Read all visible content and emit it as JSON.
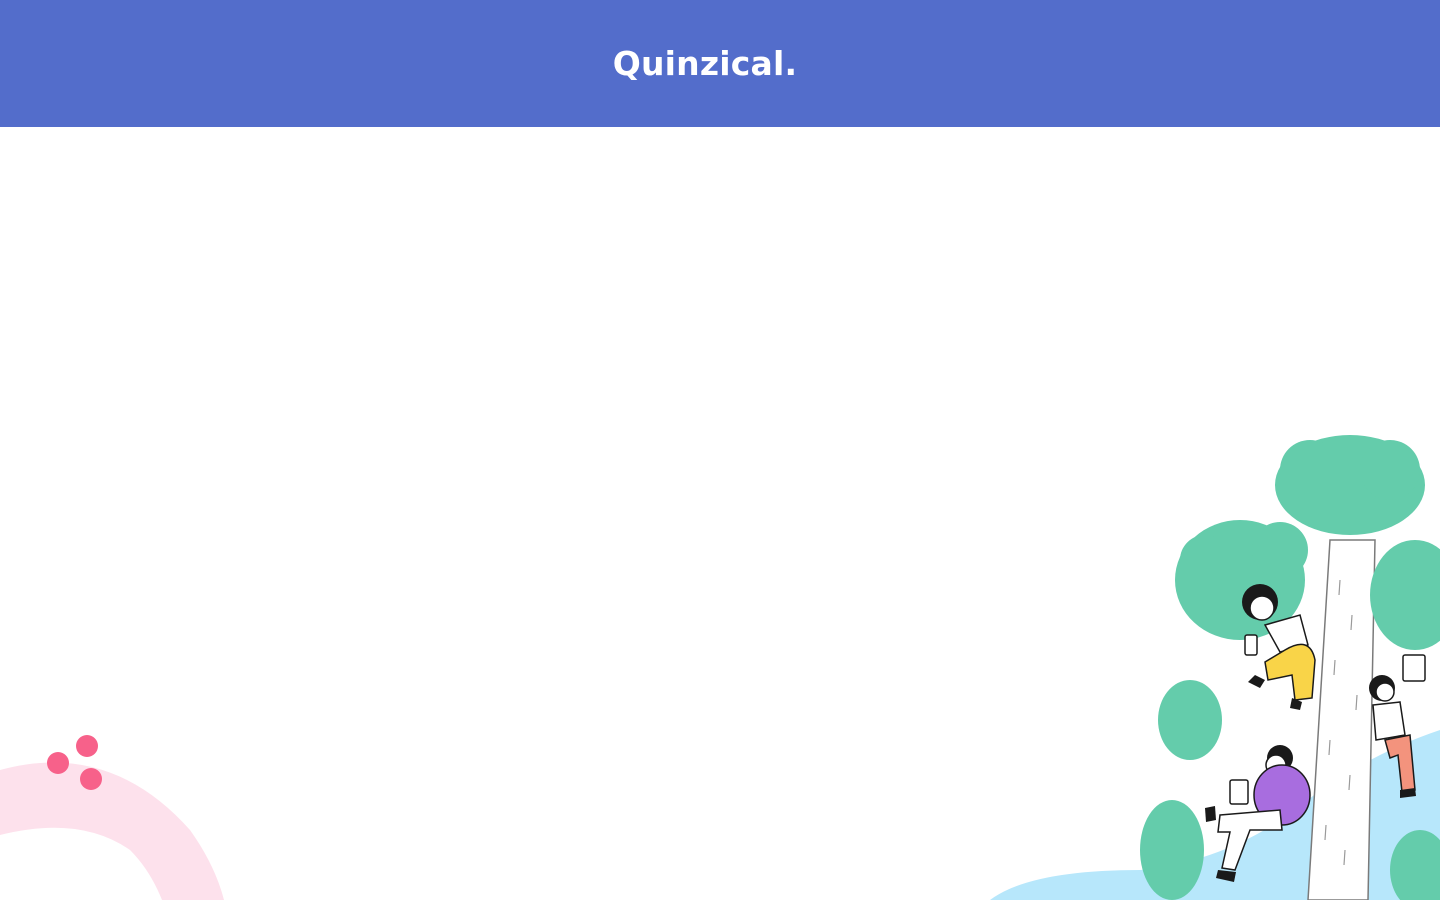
{
  "app": {
    "title": "Quinzical."
  },
  "theme": {
    "header_bg": "#536dcb",
    "accent_pink": "#f7618a",
    "arc_pink": "#fde1ec",
    "tree_green": "#64ccab",
    "path_blue": "#b7e7fb",
    "shirt_purple": "#a86ddf",
    "pants_yellow": "#f9d448",
    "pants_salmon": "#f3937d"
  },
  "illustrations": {
    "left": "pink-arc-dots",
    "right": "people-studying-on-tree"
  }
}
